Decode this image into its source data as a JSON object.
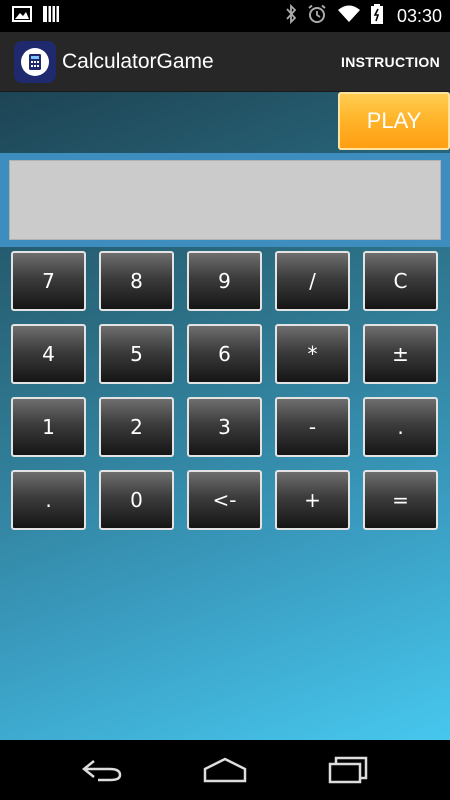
{
  "status_bar": {
    "time": "03:30",
    "icons": [
      "image-icon",
      "bars-icon",
      "bluetooth-icon",
      "alarm-icon",
      "wifi-icon",
      "battery-icon"
    ]
  },
  "action_bar": {
    "title": "CalculatorGame",
    "instruction_label": "INSTRUCTION",
    "logo_icon": "calculator-icon"
  },
  "play": {
    "label": "PLAY"
  },
  "display": {
    "value": ""
  },
  "keypad": {
    "rows": [
      [
        "7",
        "8",
        "9",
        "/",
        "C"
      ],
      [
        "4",
        "5",
        "6",
        "*",
        "±"
      ],
      [
        "1",
        "2",
        "3",
        "-",
        "."
      ],
      [
        ".",
        "0",
        "<-",
        "+",
        "="
      ]
    ]
  },
  "nav_bar": {
    "icons": [
      "back-icon",
      "home-icon",
      "recents-icon"
    ]
  },
  "colors": {
    "accent_orange": "#ffb52b",
    "display_frame": "#3d8ebf",
    "display_screen": "#cbcbcb",
    "action_bar": "#272727"
  }
}
